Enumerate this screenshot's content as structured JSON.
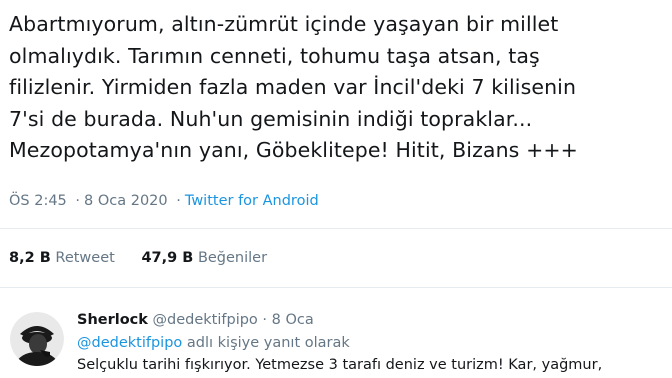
{
  "tweet": {
    "text": "Abartmıyorum, altın-zümrüt içinde yaşayan bir millet\nolmalıydık. Tarımın cenneti, tohumu taşa atsan, taş\nfilizlenir. Yirmiden fazla maden var İncil'deki 7 kilisenin\n7'si de burada. Nuh'un gemisinin indiği topraklar...\nMezopotamya'nın yanı, Göbeklitepe! Hitit, Bizans +++",
    "time": "ÖS 2:45",
    "separator": "·",
    "date": "8 Oca 2020",
    "source": "Twitter for Android"
  },
  "stats": {
    "retweet_count": "8,2 B",
    "retweet_label": "Retweet",
    "like_count": "47,9 B",
    "like_label": "Beğeniler"
  },
  "reply": {
    "name": "Sherlock",
    "handle": "@dedektifpipo",
    "separator": "·",
    "date": "8 Oca",
    "replying_mention": "@dedektifpipo",
    "replying_suffix": "adlı kişiye yanıt olarak",
    "text": "Selçuklu tarihi fışkırıyor. Yetmezse 3 tarafı deniz ve turizm! Kar, yağmur,"
  },
  "colors": {
    "link": "#1b95e0",
    "muted": "#657786",
    "text": "#14171a",
    "divider": "#e6ecf0"
  },
  "icons": {
    "avatar": "sherlock-silhouette-avatar"
  }
}
